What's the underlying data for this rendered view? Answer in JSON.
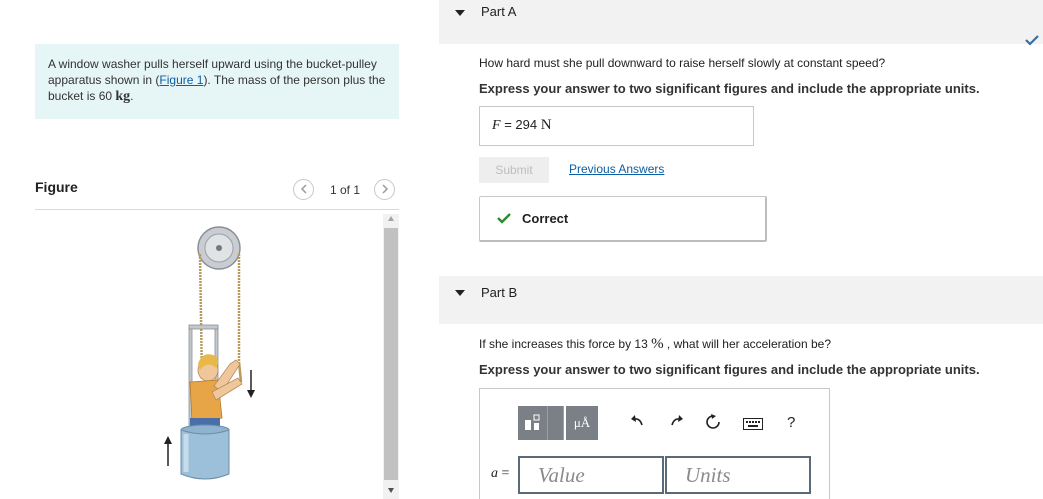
{
  "problem": {
    "text_before": "A window washer pulls herself upward using the bucket-pulley apparatus shown in (",
    "figure_link": "Figure 1",
    "text_after": "). The mass of the person plus the bucket is 60 ",
    "unit": "kg",
    "end": "."
  },
  "figure_panel": {
    "title": "Figure",
    "counter": "1 of 1",
    "prev_icon": "chevron-left-icon",
    "next_icon": "chevron-right-icon"
  },
  "part_a": {
    "label": "Part A",
    "question": "How hard must she pull downward to raise herself slowly at constant speed?",
    "instruction": "Express your answer to two significant figures and include the appropriate units.",
    "answer_variable": "F",
    "answer_equals": "=",
    "answer_value": "294",
    "answer_unit": "N",
    "submit_label": "Submit",
    "previous_answers_label": "Previous Answers",
    "feedback": "Correct",
    "status_icon": "checkmark-icon"
  },
  "part_b": {
    "label": "Part B",
    "question_before": "If she increases this force by 13 ",
    "question_percent": "%",
    "question_after": " , what will her acceleration be?",
    "instruction": "Express your answer to two significant figures and include the appropriate units.",
    "answer_variable": "a",
    "answer_equals": "=",
    "value_placeholder": "Value",
    "units_placeholder": "Units",
    "toolbar": {
      "templates_icon": "templates-icon",
      "units_button": "μÅ",
      "undo_icon": "undo-icon",
      "redo_icon": "redo-icon",
      "reset_icon": "reset-icon",
      "keyboard_icon": "keyboard-icon",
      "help_label": "?"
    }
  },
  "colors": {
    "problem_bg": "#e6f5f5",
    "link": "#0b5fa5",
    "correct_green": "#2e8b2e",
    "toolbar_gray": "#7a8086",
    "input_border": "#5a6a78"
  }
}
